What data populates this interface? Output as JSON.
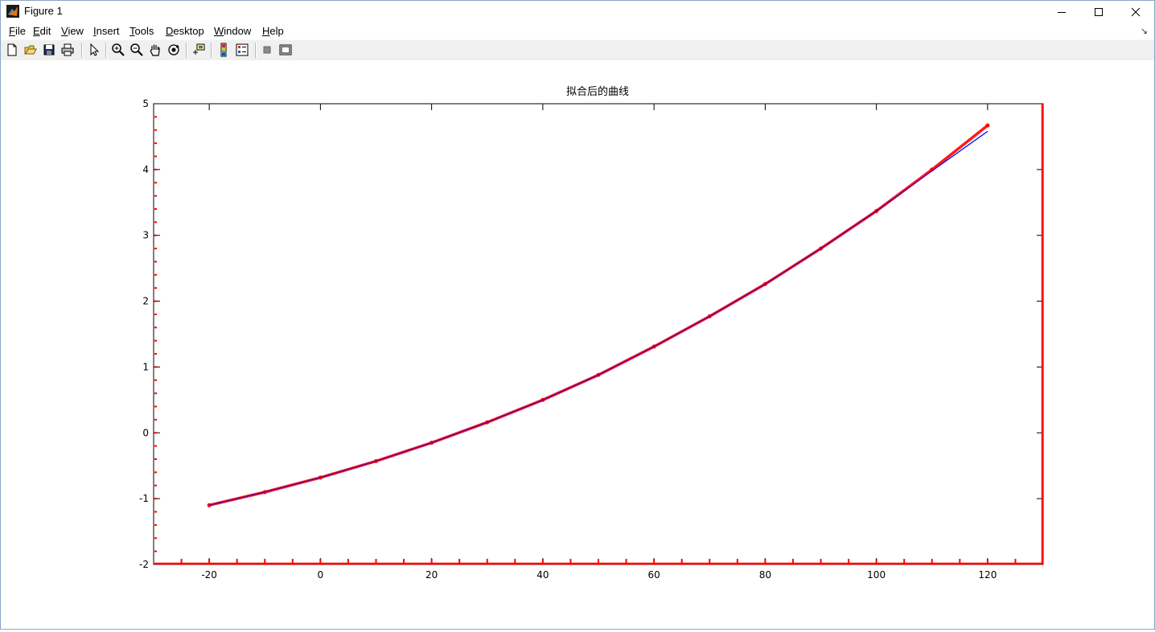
{
  "window": {
    "title": "Figure 1",
    "controls": {
      "minimize": "minimize",
      "maximize": "maximize",
      "close": "close"
    }
  },
  "menubar": {
    "items": [
      {
        "label": "File",
        "key": "F"
      },
      {
        "label": "Edit",
        "key": "E"
      },
      {
        "label": "View",
        "key": "V"
      },
      {
        "label": "Insert",
        "key": "I"
      },
      {
        "label": "Tools",
        "key": "T"
      },
      {
        "label": "Desktop",
        "key": "D"
      },
      {
        "label": "Window",
        "key": "W"
      },
      {
        "label": "Help",
        "key": "H"
      }
    ]
  },
  "toolbar": {
    "buttons": [
      "new-figure-icon",
      "open-file-icon",
      "save-icon",
      "print-icon",
      "edit-plot-arrow-icon",
      "zoom-in-icon",
      "zoom-out-icon",
      "pan-hand-icon",
      "rotate-3d-icon",
      "data-cursor-icon",
      "insert-colorbar-icon",
      "insert-legend-icon",
      "hide-plot-tools-icon",
      "show-plot-tools-icon"
    ]
  },
  "colors": {
    "fit_line": "#0000ff",
    "data_points": "#ff0000",
    "axis": "#000000"
  },
  "chart_data": {
    "type": "line",
    "title": "拟合后的曲线",
    "xlabel": "",
    "ylabel": "",
    "xlim": [
      -30,
      130
    ],
    "ylim": [
      -2,
      5
    ],
    "xticks": [
      -20,
      0,
      20,
      40,
      60,
      80,
      100,
      120
    ],
    "yticks": [
      -2,
      -1,
      0,
      1,
      2,
      3,
      4,
      5
    ],
    "grid": false,
    "series": [
      {
        "style": "line",
        "color": "#0000ff",
        "x": [
          -20,
          -10,
          0,
          10,
          20,
          30,
          40,
          50,
          60,
          70,
          80,
          90,
          100,
          110,
          120
        ],
        "y": [
          -1.1,
          -0.9,
          -0.68,
          -0.43,
          -0.15,
          0.16,
          0.5,
          0.88,
          1.31,
          1.77,
          2.26,
          2.8,
          3.37,
          3.98,
          4.58
        ]
      },
      {
        "style": "markers",
        "color": "#ff0000",
        "x": [
          -20,
          -10,
          0,
          10,
          20,
          30,
          40,
          50,
          60,
          70,
          80,
          90,
          100,
          110,
          120
        ],
        "y": [
          -1.1,
          -0.9,
          -0.68,
          -0.43,
          -0.15,
          0.16,
          0.5,
          0.88,
          1.31,
          1.77,
          2.26,
          2.8,
          3.37,
          4.0,
          4.67
        ]
      }
    ]
  }
}
